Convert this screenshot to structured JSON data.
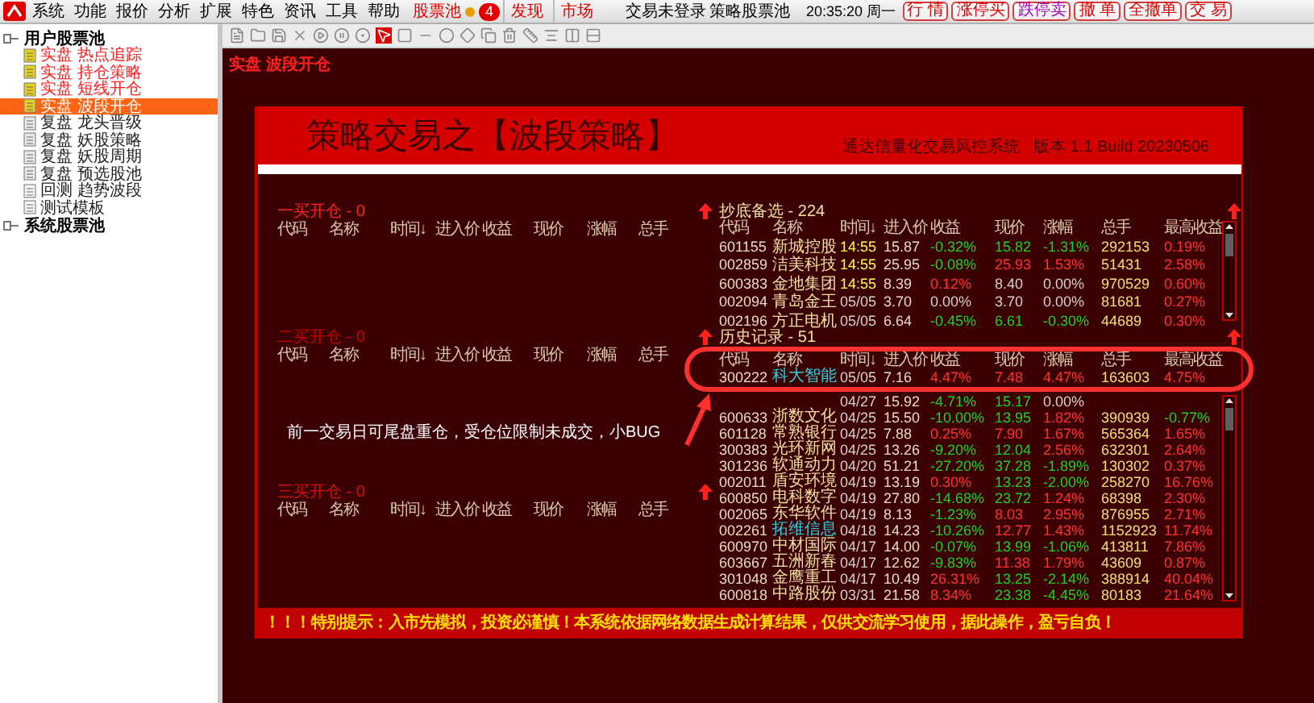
{
  "menubar": {
    "menus": [
      "系统",
      "功能",
      "报价",
      "分析",
      "扩展",
      "特色",
      "资讯",
      "工具",
      "帮助"
    ],
    "pool": {
      "label": "股票池",
      "badge": "4"
    },
    "links": [
      "发现",
      "市场"
    ],
    "status": "交易未登录",
    "pool_name": "策略股票池",
    "clock": "20:35:20 周一",
    "buttons": [
      {
        "label": "行 情",
        "color": "#e00000"
      },
      {
        "label": "涨停买",
        "color": "#e00000"
      },
      {
        "label": "跌停卖",
        "color": "#a000c0"
      },
      {
        "label": "撤 单",
        "color": "#e00000"
      },
      {
        "label": "全撤单",
        "color": "#e00000"
      },
      {
        "label": "交 易",
        "color": "#e00000"
      }
    ]
  },
  "sidebar": {
    "groups": [
      {
        "label": "用户股票池",
        "children": [
          {
            "label": "实盘 热点追踪",
            "kind": "live",
            "selected": false
          },
          {
            "label": "实盘 持仓策略",
            "kind": "live",
            "selected": false
          },
          {
            "label": "实盘 短线开仓",
            "kind": "live",
            "selected": false
          },
          {
            "label": "实盘 波段开仓",
            "kind": "live",
            "selected": true
          },
          {
            "label": "复盘 龙头晋级",
            "kind": "replay",
            "selected": false
          },
          {
            "label": "复盘 妖股策略",
            "kind": "replay",
            "selected": false
          },
          {
            "label": "复盘 妖股周期",
            "kind": "replay",
            "selected": false
          },
          {
            "label": "复盘 预选股池",
            "kind": "replay",
            "selected": false
          },
          {
            "label": "回测 趋势波段",
            "kind": "test",
            "selected": false
          },
          {
            "label": "测试模板",
            "kind": "test",
            "selected": false
          }
        ]
      },
      {
        "label": "系统股票池"
      }
    ]
  },
  "breadcrumb": "实盘 波段开仓",
  "banner": {
    "title": "策略交易之【波段策略】",
    "subtitle": "通达信量化交易风控系统   版本 1.1 Build 20230506"
  },
  "left_tables": [
    {
      "title": "一买开仓 - 0",
      "color": "#ff2020",
      "columns": [
        "代码",
        "名称",
        "时间↓",
        "进入价",
        "收益",
        "现价",
        "涨幅",
        "总手"
      ]
    },
    {
      "title": "二买开仓 - 0",
      "color": "#c00000",
      "columns": [
        "代码",
        "名称",
        "时间↓",
        "进入价",
        "收益",
        "现价",
        "涨幅",
        "总手"
      ]
    },
    {
      "title": "三买开仓 - 0",
      "color": "#d01010",
      "columns": [
        "代码",
        "名称",
        "时间↓",
        "进入价",
        "收益",
        "现价",
        "涨幅",
        "总手"
      ]
    }
  ],
  "annotation": "前一交易日可尾盘重仓，受仓位限制未成交，小BUG",
  "right_tables": [
    {
      "title": "抄底备选 - 224",
      "columns": [
        "代码",
        "名称",
        "时间↓",
        "进入价",
        "收益",
        "现价",
        "涨幅",
        "总手",
        "最高收益"
      ],
      "rows": [
        {
          "code": "601155",
          "name": "新城控股",
          "color": "#f0e0a0",
          "time": {
            "text": "14:55",
            "color": "#ffff50"
          },
          "entry": "15.87",
          "gain": {
            "text": "-0.32%",
            "color": "#20d020"
          },
          "price": {
            "text": "15.82",
            "color": "#20d020"
          },
          "change": {
            "text": "-1.31%",
            "color": "#20d020"
          },
          "volume": "292153",
          "high": {
            "text": "0.19%",
            "color": "#ff3030"
          }
        },
        {
          "code": "002859",
          "name": "洁美科技",
          "color": "#f0e0a0",
          "time": {
            "text": "14:55",
            "color": "#ffff50"
          },
          "entry": "25.95",
          "gain": {
            "text": "-0.08%",
            "color": "#20d020"
          },
          "price": {
            "text": "25.93",
            "color": "#ff3030"
          },
          "change": {
            "text": "1.53%",
            "color": "#ff3030"
          },
          "volume": "51431",
          "high": {
            "text": "2.58%",
            "color": "#ff3030"
          }
        },
        {
          "code": "600383",
          "name": "金地集团",
          "color": "#f0e0a0",
          "time": {
            "text": "14:55",
            "color": "#ffff50"
          },
          "entry": "8.39",
          "gain": {
            "text": "0.12%",
            "color": "#ff3030"
          },
          "price": {
            "text": "8.40",
            "color": "#d8d0c8"
          },
          "change": {
            "text": "0.00%",
            "color": "#d8d0c8"
          },
          "volume": "970529",
          "high": {
            "text": "0.60%",
            "color": "#ff3030"
          }
        },
        {
          "code": "002094",
          "name": "青岛金王",
          "color": "#f0e0a0",
          "time": {
            "text": "05/05",
            "color": "#d8d0c8"
          },
          "entry": "3.70",
          "gain": {
            "text": "0.00%",
            "color": "#d8d0c8"
          },
          "price": {
            "text": "3.70",
            "color": "#d8d0c8"
          },
          "change": {
            "text": "0.00%",
            "color": "#d8d0c8"
          },
          "volume": "81681",
          "high": {
            "text": "0.27%",
            "color": "#ff3030"
          }
        },
        {
          "code": "002196",
          "name": "方正电机",
          "color": "#f0e0a0",
          "time": {
            "text": "05/05",
            "color": "#d8d0c8"
          },
          "entry": "6.64",
          "gain": {
            "text": "-0.45%",
            "color": "#20d020"
          },
          "price": {
            "text": "6.61",
            "color": "#20d020"
          },
          "change": {
            "text": "-0.30%",
            "color": "#20d020"
          },
          "volume": "44689",
          "high": {
            "text": "0.30%",
            "color": "#ff3030"
          }
        }
      ]
    },
    {
      "title": "历史记录 - 51",
      "columns": [
        "代码",
        "名称",
        "时间↓",
        "进入价",
        "收益",
        "现价",
        "涨幅",
        "总手",
        "最高收益"
      ],
      "rows": [
        {
          "code": "300222",
          "name": "科大智能",
          "color": "#30d0e0",
          "time": {
            "text": "05/05",
            "color": "#d8d0c8"
          },
          "entry": "7.16",
          "gain": {
            "text": "4.47%",
            "color": "#ff3030"
          },
          "price": {
            "text": "7.48",
            "color": "#ff3030"
          },
          "change": {
            "text": "4.47%",
            "color": "#ff3030"
          },
          "volume": "163603",
          "high": {
            "text": "4.75%",
            "color": "#ff3030"
          }
        },
        {
          "time": {
            "text": "04/27",
            "color": "#d8d0c8"
          },
          "entry": "15.92",
          "gain": {
            "text": "-4.71%",
            "color": "#20d020"
          },
          "price": {
            "text": "15.17",
            "color": "#20d020"
          },
          "change": {
            "text": "0.00%",
            "color": "#d8d0c8"
          }
        },
        {
          "code": "600633",
          "name": "浙数文化",
          "color": "#f0e0a0",
          "time": {
            "text": "04/25",
            "color": "#d8d0c8"
          },
          "entry": "15.50",
          "gain": {
            "text": "-10.00%",
            "color": "#20d020"
          },
          "price": {
            "text": "13.95",
            "color": "#20d020"
          },
          "change": {
            "text": "1.82%",
            "color": "#ff3030"
          },
          "volume": "390939",
          "high": {
            "text": "-0.77%",
            "color": "#20d020"
          }
        },
        {
          "code": "601128",
          "name": "常熟银行",
          "color": "#f0e0a0",
          "time": {
            "text": "04/25",
            "color": "#d8d0c8"
          },
          "entry": "7.88",
          "gain": {
            "text": "0.25%",
            "color": "#ff3030"
          },
          "price": {
            "text": "7.90",
            "color": "#ff3030"
          },
          "change": {
            "text": "1.67%",
            "color": "#ff3030"
          },
          "volume": "565364",
          "high": {
            "text": "1.65%",
            "color": "#ff3030"
          }
        },
        {
          "code": "300383",
          "name": "光环新网",
          "color": "#f0e0a0",
          "time": {
            "text": "04/25",
            "color": "#d8d0c8"
          },
          "entry": "13.26",
          "gain": {
            "text": "-9.20%",
            "color": "#20d020"
          },
          "price": {
            "text": "12.04",
            "color": "#20d020"
          },
          "change": {
            "text": "2.56%",
            "color": "#ff3030"
          },
          "volume": "632301",
          "high": {
            "text": "2.64%",
            "color": "#ff3030"
          }
        },
        {
          "code": "301236",
          "name": "软通动力",
          "color": "#f0e0a0",
          "time": {
            "text": "04/20",
            "color": "#d8d0c8"
          },
          "entry": "51.21",
          "gain": {
            "text": "-27.20%",
            "color": "#20d020"
          },
          "price": {
            "text": "37.28",
            "color": "#20d020"
          },
          "change": {
            "text": "-1.89%",
            "color": "#20d020"
          },
          "volume": "130302",
          "high": {
            "text": "0.37%",
            "color": "#ff3030"
          }
        },
        {
          "code": "002011",
          "name": "盾安环境",
          "color": "#f0e0a0",
          "time": {
            "text": "04/19",
            "color": "#d8d0c8"
          },
          "entry": "13.19",
          "gain": {
            "text": "0.30%",
            "color": "#ff3030"
          },
          "price": {
            "text": "13.23",
            "color": "#20d020"
          },
          "change": {
            "text": "-2.00%",
            "color": "#20d020"
          },
          "volume": "258270",
          "high": {
            "text": "16.76%",
            "color": "#ff3030"
          }
        },
        {
          "code": "600850",
          "name": "电科数字",
          "color": "#f0e0a0",
          "time": {
            "text": "04/19",
            "color": "#d8d0c8"
          },
          "entry": "27.80",
          "gain": {
            "text": "-14.68%",
            "color": "#20d020"
          },
          "price": {
            "text": "23.72",
            "color": "#20d020"
          },
          "change": {
            "text": "1.24%",
            "color": "#ff3030"
          },
          "volume": "68398",
          "high": {
            "text": "2.30%",
            "color": "#ff3030"
          }
        },
        {
          "code": "002065",
          "name": "东华软件",
          "color": "#f0e0a0",
          "time": {
            "text": "04/19",
            "color": "#d8d0c8"
          },
          "entry": "8.13",
          "gain": {
            "text": "-1.23%",
            "color": "#20d020"
          },
          "price": {
            "text": "8.03",
            "color": "#ff3030"
          },
          "change": {
            "text": "2.95%",
            "color": "#ff3030"
          },
          "volume": "876955",
          "high": {
            "text": "2.71%",
            "color": "#ff3030"
          }
        },
        {
          "code": "002261",
          "name": "拓维信息",
          "color": "#30d0e0",
          "time": {
            "text": "04/18",
            "color": "#d8d0c8"
          },
          "entry": "14.23",
          "gain": {
            "text": "-10.26%",
            "color": "#20d020"
          },
          "price": {
            "text": "12.77",
            "color": "#ff3030"
          },
          "change": {
            "text": "1.43%",
            "color": "#ff3030"
          },
          "volume": "1152923",
          "high": {
            "text": "11.74%",
            "color": "#ff3030"
          }
        },
        {
          "code": "600970",
          "name": "中材国际",
          "color": "#f0e0a0",
          "time": {
            "text": "04/17",
            "color": "#d8d0c8"
          },
          "entry": "14.00",
          "gain": {
            "text": "-0.07%",
            "color": "#20d020"
          },
          "price": {
            "text": "13.99",
            "color": "#20d020"
          },
          "change": {
            "text": "-1.06%",
            "color": "#20d020"
          },
          "volume": "413811",
          "high": {
            "text": "7.86%",
            "color": "#ff3030"
          }
        },
        {
          "code": "603667",
          "name": "五洲新春",
          "color": "#f0e0a0",
          "time": {
            "text": "04/17",
            "color": "#d8d0c8"
          },
          "entry": "12.62",
          "gain": {
            "text": "-9.83%",
            "color": "#20d020"
          },
          "price": {
            "text": "11.38",
            "color": "#ff3030"
          },
          "change": {
            "text": "1.79%",
            "color": "#ff3030"
          },
          "volume": "43609",
          "high": {
            "text": "0.87%",
            "color": "#ff3030"
          }
        },
        {
          "code": "301048",
          "name": "金鹰重工",
          "color": "#f0e0a0",
          "time": {
            "text": "04/17",
            "color": "#d8d0c8"
          },
          "entry": "10.49",
          "gain": {
            "text": "26.31%",
            "color": "#ff3030"
          },
          "price": {
            "text": "13.25",
            "color": "#20d020"
          },
          "change": {
            "text": "-2.14%",
            "color": "#20d020"
          },
          "volume": "388914",
          "high": {
            "text": "40.04%",
            "color": "#ff3030"
          }
        },
        {
          "code": "600818",
          "name": "中路股份",
          "color": "#f0e0a0",
          "time": {
            "text": "03/31",
            "color": "#d8d0c8"
          },
          "entry": "21.58",
          "gain": {
            "text": "8.34%",
            "color": "#ff3030"
          },
          "price": {
            "text": "23.38",
            "color": "#20d020"
          },
          "change": {
            "text": "-4.45%",
            "color": "#20d020"
          },
          "volume": "80183",
          "high": {
            "text": "21.64%",
            "color": "#ff3030"
          }
        }
      ]
    }
  ],
  "notice": "！！！特别提示：入市先模拟，投资必谨慎！本系统依据网络数据生成计算结果，仅供交流学习使用，据此操作，盈亏自负！"
}
